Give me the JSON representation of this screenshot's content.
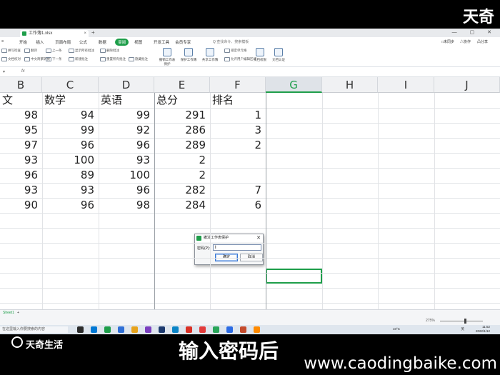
{
  "overlay": {
    "brand_top": "天奇",
    "brand_bottom": "天奇生活",
    "subtitle": "输入密码后",
    "watermark": "www.caodingbaike.com"
  },
  "window": {
    "tab_title": "工作簿1.xlsx",
    "tab_close": "×",
    "tab_add": "+",
    "controls": "—  ▢  ✕"
  },
  "menu": {
    "items": [
      "开始",
      "插入",
      "页面布局",
      "公式",
      "数据",
      "审阅",
      "视图",
      "开发工具",
      "会员专享"
    ],
    "active_index": 5,
    "search": "Q 查找命令、搜索模板",
    "right": [
      "□未同步",
      "△协作",
      "凸分享"
    ]
  },
  "toolbar": {
    "small_tools": [
      "拼写检查",
      "文档校对",
      "翻译",
      "中文简繁转换",
      "上一条",
      "下一条",
      "显示所有批注",
      "新建批注",
      "删除批注",
      "重置所有批注",
      "隐藏批注",
      "取消保护工作表",
      "保护工作簿",
      "允许用户编辑区域"
    ],
    "big_tools": [
      "撤销工作表保护",
      "保护工作簿",
      "共享工作簿",
      "锁定单元格",
      "文档权限",
      "文档认证"
    ]
  },
  "formula_bar": {
    "fx": "fx"
  },
  "sheet": {
    "columns": [
      "B",
      "C",
      "D",
      "E",
      "F",
      "G",
      "H",
      "I",
      "J"
    ],
    "selected_column": "G",
    "header_row": [
      "文",
      "数学",
      "英语",
      "总分",
      "排名"
    ],
    "rows": [
      [
        98,
        94,
        99,
        291,
        1
      ],
      [
        95,
        99,
        92,
        286,
        3
      ],
      [
        97,
        96,
        96,
        289,
        2
      ],
      [
        93,
        100,
        93,
        "2",
        ""
      ],
      [
        96,
        89,
        100,
        "2",
        ""
      ],
      [
        93,
        93,
        96,
        282,
        7
      ],
      [
        90,
        96,
        98,
        284,
        6
      ]
    ],
    "sheet_tab": "Sheet1",
    "sheet_add": "+"
  },
  "dialog": {
    "title": "撤消工作表保护",
    "close": "✕",
    "password_label": "密码(P):",
    "password_value": "I",
    "ok": "确定",
    "cancel": "取消"
  },
  "status": {
    "zoom": "275%"
  },
  "taskbar": {
    "search_placeholder": "在这里输入你要搜索的内容",
    "temperature": "10°C",
    "lang": "英",
    "time": "11:52",
    "date": "2022/1/12",
    "app_colors": [
      "#2b2b2b",
      "#0078d4",
      "#1e9e4a",
      "#2f6fd6",
      "#e7a31c",
      "#7b3fbf",
      "#1d3a6e",
      "#0a84c6",
      "#d93025",
      "#e23b3b",
      "#2aa65a",
      "#2b6be4",
      "#c44b2c",
      "#ff8a00"
    ]
  }
}
